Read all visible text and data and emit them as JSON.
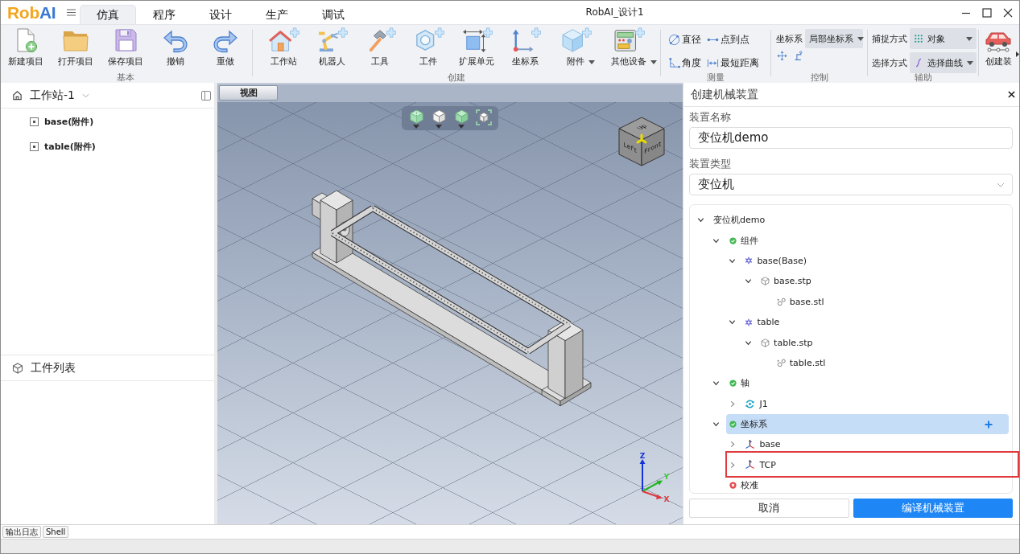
{
  "app": {
    "logo": [
      {
        "text": "Rob",
        "color": "#f2a51f"
      },
      {
        "text": "AI",
        "color": "#3b78d4"
      }
    ],
    "title": "RobAI_设计1"
  },
  "tabs": [
    {
      "label": "仿真",
      "selected": true
    },
    {
      "label": "程序",
      "selected": false
    },
    {
      "label": "设计",
      "selected": false
    },
    {
      "label": "生产",
      "selected": false
    },
    {
      "label": "调试",
      "selected": false
    }
  ],
  "ribbon": [
    {
      "kind": "buttons",
      "label": "基本",
      "items": [
        {
          "label": "新建项目",
          "has_menu": false
        },
        {
          "label": "打开项目",
          "has_menu": false
        },
        {
          "label": "保存项目",
          "has_menu": false
        },
        {
          "label": "撤销",
          "has_menu": false
        },
        {
          "label": "重做",
          "has_menu": false
        }
      ]
    },
    {
      "kind": "buttons",
      "label": "创建",
      "items": [
        {
          "label": "工作站",
          "has_menu": false
        },
        {
          "label": "机器人",
          "has_menu": false
        },
        {
          "label": "工具",
          "has_menu": false
        },
        {
          "label": "工件",
          "has_menu": false
        },
        {
          "label": "扩展单元",
          "has_menu": false
        },
        {
          "label": "坐标系",
          "has_menu": false
        },
        {
          "label": "附件",
          "has_menu": true
        },
        {
          "label": "其他设备",
          "has_menu": true
        }
      ]
    },
    {
      "kind": "measure",
      "label": "测量",
      "items": [
        {
          "label": "直径"
        },
        {
          "label": "点到点"
        },
        {
          "label": "角度"
        },
        {
          "label": "最短距离"
        }
      ]
    },
    {
      "kind": "control",
      "label": "控制",
      "fields": [
        {
          "label": "坐标系",
          "value": "局部坐标系"
        }
      ]
    },
    {
      "kind": "assist",
      "label": "辅助",
      "fields": [
        {
          "label": "捕捉方式",
          "value": "对象"
        },
        {
          "label": "选择方式",
          "value": "选择曲线"
        }
      ]
    },
    {
      "kind": "buttons",
      "items": [
        {
          "label": "创建装",
          "has_menu": false
        }
      ]
    }
  ],
  "workstation": {
    "title": "工作站-1",
    "items": [
      {
        "label": "base(附件)"
      },
      {
        "label": "table(附件)"
      }
    ]
  },
  "parts_list": {
    "title": "工件列表"
  },
  "viewport": {
    "tab": "视图",
    "view_cube": {
      "top": "Up",
      "left": "Left",
      "front": "Front"
    },
    "axes": {
      "x": "X",
      "y": "Y",
      "z": "Z"
    }
  },
  "device_panel": {
    "title": "创建机械装置",
    "name_field": {
      "label": "装置名称",
      "value": "变位机demo"
    },
    "type_field": {
      "label": "装置类型",
      "value": "变位机"
    },
    "tree": [
      {
        "label": "变位机demo",
        "expanded": true,
        "selected": false,
        "marked": false,
        "children": [
          {
            "label": "组件",
            "kind": "group",
            "valid": true,
            "expanded": true,
            "selected": false,
            "marked": false,
            "children": [
              {
                "label": "base(Base)",
                "kind": "link",
                "expanded": true,
                "selected": false,
                "marked": false,
                "children": [
                  {
                    "label": "base.stp",
                    "kind": "model",
                    "expanded": true,
                    "selected": false,
                    "marked": false,
                    "children": [
                      {
                        "label": "base.stl",
                        "kind": "mesh",
                        "selected": false,
                        "marked": false
                      }
                    ]
                  }
                ]
              },
              {
                "label": "table",
                "kind": "link",
                "expanded": true,
                "selected": false,
                "marked": false,
                "children": [
                  {
                    "label": "table.stp",
                    "kind": "model",
                    "expanded": true,
                    "selected": false,
                    "marked": false,
                    "children": [
                      {
                        "label": "table.stl",
                        "kind": "mesh",
                        "selected": false,
                        "marked": false
                      }
                    ]
                  }
                ]
              }
            ]
          },
          {
            "label": "轴",
            "kind": "group",
            "valid": true,
            "expanded": true,
            "selected": false,
            "marked": false,
            "children": [
              {
                "label": "J1",
                "kind": "joint",
                "expanded": false,
                "selected": false,
                "marked": false
              }
            ]
          },
          {
            "label": "坐标系",
            "kind": "group",
            "valid": true,
            "expanded": true,
            "selected": true,
            "marked": false,
            "children": [
              {
                "label": "base",
                "kind": "frame",
                "expanded": false,
                "selected": false,
                "marked": false
              },
              {
                "label": "TCP",
                "kind": "frame",
                "expanded": false,
                "selected": false,
                "marked": true
              }
            ]
          },
          {
            "label": "校准",
            "kind": "group",
            "valid": false,
            "selected": false,
            "marked": false
          }
        ]
      }
    ],
    "buttons": [
      {
        "label": "取消",
        "kind": "secondary"
      },
      {
        "label": "编译机械装置",
        "kind": "primary"
      }
    ]
  },
  "output_tabs": [
    {
      "label": "输出日志"
    },
    {
      "label": "Shell"
    }
  ]
}
